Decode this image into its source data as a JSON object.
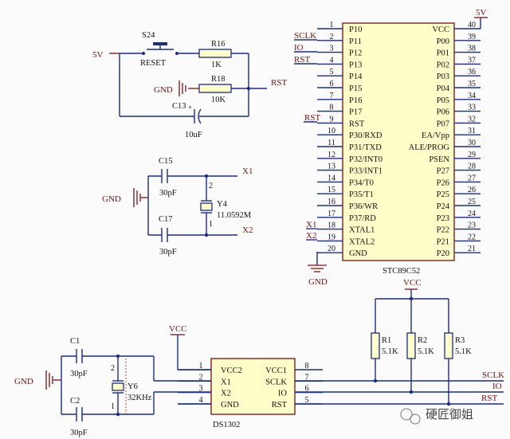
{
  "reset": {
    "net_5v": "5V",
    "button_ref": "S24",
    "button_value": "RESET",
    "r16": {
      "ref": "R16",
      "value": "1K"
    },
    "r18": {
      "ref": "R18",
      "value": "10K"
    },
    "gnd": "GND",
    "net_rst": "RST",
    "c13": {
      "ref": "C13",
      "value": "10uF"
    }
  },
  "crystal": {
    "gnd": "GND",
    "c15": {
      "ref": "C15",
      "value": "30pF"
    },
    "c17": {
      "ref": "C17",
      "value": "30pF"
    },
    "y4": {
      "ref": "Y4",
      "value": "11.0592M"
    },
    "net_x1": "X1",
    "net_x2": "X2"
  },
  "mcu": {
    "name": "STC89C52",
    "net_sclk": "SCLK",
    "net_io": "IO",
    "net_rst": "RST",
    "net_rst2": "RST",
    "net_x1": "X1",
    "net_x2": "X2",
    "gnd": "GND",
    "net_5v": "5V",
    "left_pins": [
      {
        "num": "1",
        "name": "P10"
      },
      {
        "num": "2",
        "name": "P11"
      },
      {
        "num": "3",
        "name": "P12"
      },
      {
        "num": "4",
        "name": "P13"
      },
      {
        "num": "5",
        "name": "P14"
      },
      {
        "num": "6",
        "name": "P15"
      },
      {
        "num": "7",
        "name": "P16"
      },
      {
        "num": "8",
        "name": "P17"
      },
      {
        "num": "9",
        "name": "RST"
      },
      {
        "num": "10",
        "name": "P30/RXD"
      },
      {
        "num": "11",
        "name": "P31/TXD"
      },
      {
        "num": "12",
        "name": "P32/INT0"
      },
      {
        "num": "13",
        "name": "P33/INT1"
      },
      {
        "num": "14",
        "name": "P34/T0"
      },
      {
        "num": "15",
        "name": "P35/T1"
      },
      {
        "num": "16",
        "name": "P36/WR"
      },
      {
        "num": "17",
        "name": "P37/RD"
      },
      {
        "num": "18",
        "name": "XTAL1"
      },
      {
        "num": "19",
        "name": "XTAL2"
      },
      {
        "num": "20",
        "name": "GND"
      }
    ],
    "right_pins": [
      {
        "num": "40",
        "name": "VCC"
      },
      {
        "num": "39",
        "name": "P00"
      },
      {
        "num": "38",
        "name": "P01"
      },
      {
        "num": "37",
        "name": "P02"
      },
      {
        "num": "36",
        "name": "P03"
      },
      {
        "num": "35",
        "name": "P04"
      },
      {
        "num": "34",
        "name": "P05"
      },
      {
        "num": "33",
        "name": "P06"
      },
      {
        "num": "32",
        "name": "P07"
      },
      {
        "num": "31",
        "name": "EA/Vpp"
      },
      {
        "num": "30",
        "name": "ALE/PROG"
      },
      {
        "num": "29",
        "name": "PSEN"
      },
      {
        "num": "28",
        "name": "P27"
      },
      {
        "num": "27",
        "name": "P26"
      },
      {
        "num": "26",
        "name": "P25"
      },
      {
        "num": "25",
        "name": "P24"
      },
      {
        "num": "24",
        "name": "P23"
      },
      {
        "num": "23",
        "name": "P22"
      },
      {
        "num": "22",
        "name": "P21"
      },
      {
        "num": "21",
        "name": "P20"
      }
    ]
  },
  "pullups": {
    "vcc": "VCC",
    "resistors": [
      {
        "ref": "R1",
        "value": "5.1K"
      },
      {
        "ref": "R2",
        "value": "5.1K"
      },
      {
        "ref": "R3",
        "value": "5.1K"
      }
    ]
  },
  "rtc": {
    "name": "DS1302",
    "vcc": "VCC",
    "gnd": "GND",
    "c1": {
      "ref": "C1",
      "value": "30pF"
    },
    "c2": {
      "ref": "C2",
      "value": "30pF"
    },
    "y6": {
      "ref": "Y6",
      "value": "32KHz"
    },
    "net_sclk": "SCLK",
    "net_io": "IO",
    "net_rst": "RST",
    "left_pins": [
      {
        "num": "1",
        "name": "VCC2"
      },
      {
        "num": "2",
        "name": "X1"
      },
      {
        "num": "3",
        "name": "X2"
      },
      {
        "num": "4",
        "name": "GND"
      }
    ],
    "right_pins": [
      {
        "num": "8",
        "name": "VCC1"
      },
      {
        "num": "7",
        "name": "SCLK"
      },
      {
        "num": "6",
        "name": "IO"
      },
      {
        "num": "5",
        "name": "RST"
      }
    ]
  },
  "watermark": "硬匠御姐"
}
